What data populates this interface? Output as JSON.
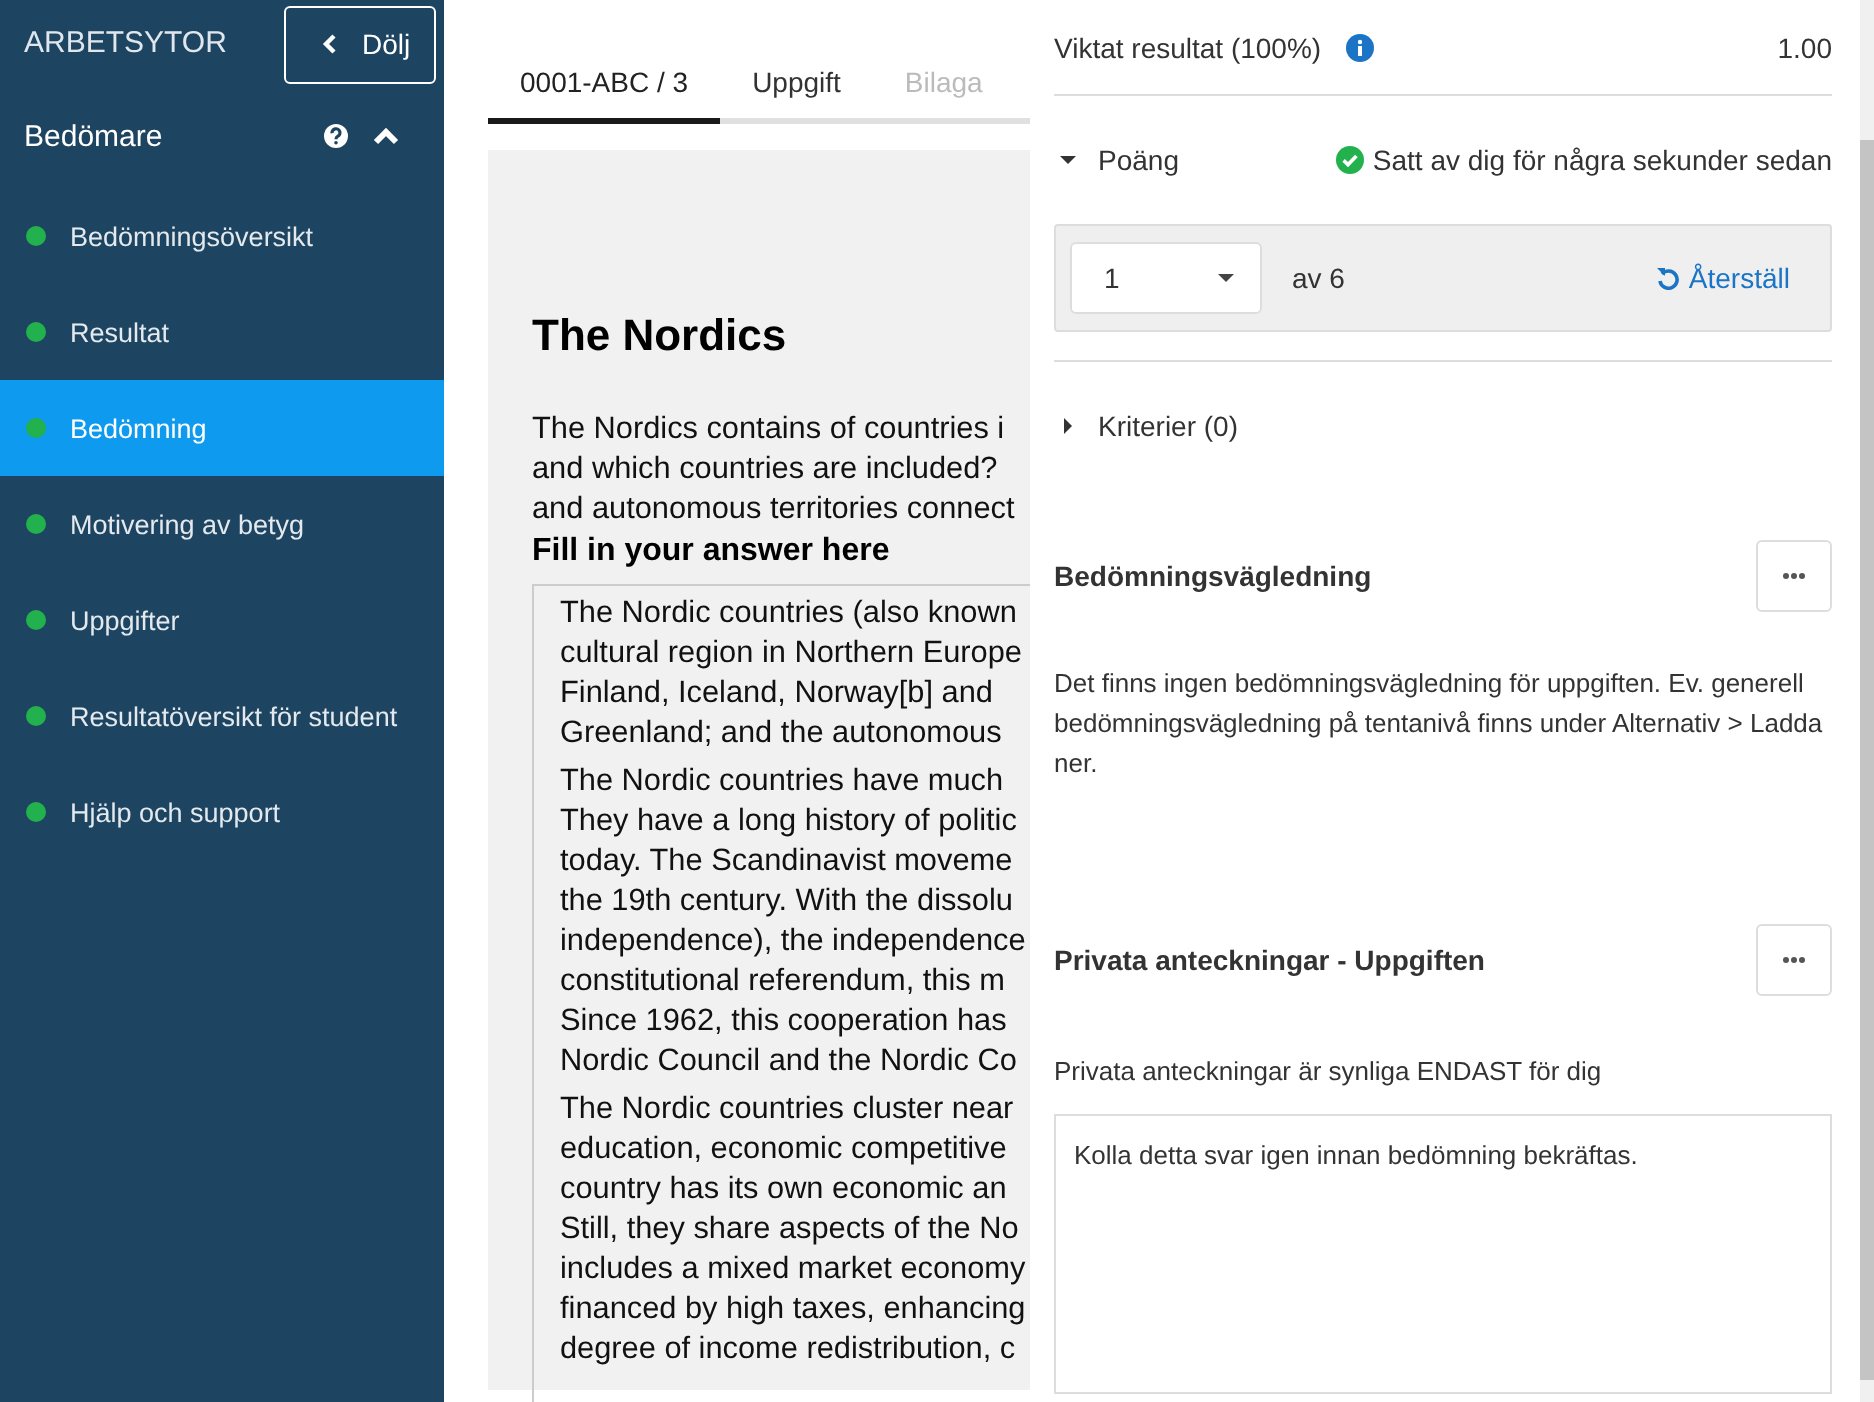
{
  "sidebar": {
    "title": "ARBETSYTOR",
    "hide_button": "Dölj",
    "section": {
      "title": "Bedömare",
      "expanded": true
    },
    "items": [
      {
        "label": "Bedömningsöversikt",
        "selected": false,
        "color": "#22b14c"
      },
      {
        "label": "Resultat",
        "selected": false,
        "color": "#22b14c"
      },
      {
        "label": "Bedömning",
        "selected": true,
        "color": "#22b14c"
      },
      {
        "label": "Motivering av betyg",
        "selected": false,
        "color": "#22b14c"
      },
      {
        "label": "Uppgifter",
        "selected": false,
        "color": "#22b14c"
      },
      {
        "label": "Resultatöversikt för student",
        "selected": false,
        "color": "#22b14c"
      },
      {
        "label": "Hjälp och support",
        "selected": false,
        "color": "#22b14c"
      }
    ]
  },
  "tabs": [
    {
      "label": "0001-ABC / 3",
      "selected": true,
      "disabled": false
    },
    {
      "label": "Uppgift",
      "selected": false,
      "disabled": false
    },
    {
      "label": "Bilaga",
      "selected": false,
      "disabled": true
    }
  ],
  "document": {
    "title": "The Nordics",
    "intro_lines": [
      "The Nordics contains of countries i",
      "and which countries are included?",
      "and autonomous territories connect"
    ],
    "answer_label": "Fill in your answer here",
    "answer_paragraphs": [
      [
        "The Nordic countries (also known",
        "cultural region in Northern Europe",
        "Finland, Iceland, Norway[b] and",
        "Greenland; and the autonomous"
      ],
      [
        "The Nordic countries have much",
        "They have a long history of politic",
        "today. The Scandinavist moveme",
        "the 19th century. With the dissolu",
        "independence), the independence",
        "constitutional referendum, this m",
        "Since 1962, this cooperation has",
        "Nordic Council and the Nordic Co"
      ],
      [
        "The Nordic countries cluster near",
        "education, economic competitive",
        "country has its own economic an",
        "Still, they share aspects of the No",
        "includes a mixed market economy",
        "financed by high taxes, enhancing",
        "degree of income redistribution, c"
      ]
    ]
  },
  "panel": {
    "weighted_result": {
      "label": "Viktat resultat (100%)",
      "value": "1.00"
    },
    "points": {
      "label": "Poäng",
      "expanded": true,
      "status": "Satt av dig för några sekunder sedan",
      "value": "1",
      "max_text": "av 6",
      "reset": "Återställ"
    },
    "criteria": {
      "label": "Kriterier (0)",
      "expanded": false
    },
    "guidance": {
      "title": "Bedömningsvägledning",
      "text": "Det finns ingen bedömningsvägledning för uppgiften. Ev. generell bedömningsvägledning på tentanivå finns under Alternativ > Ladda ner."
    },
    "notes": {
      "title": "Privata anteckningar - Uppgiften",
      "hint": "Privata anteckningar är synliga ENDAST för dig",
      "value": "Kolla detta svar igen innan bedömning bekräftas."
    }
  }
}
